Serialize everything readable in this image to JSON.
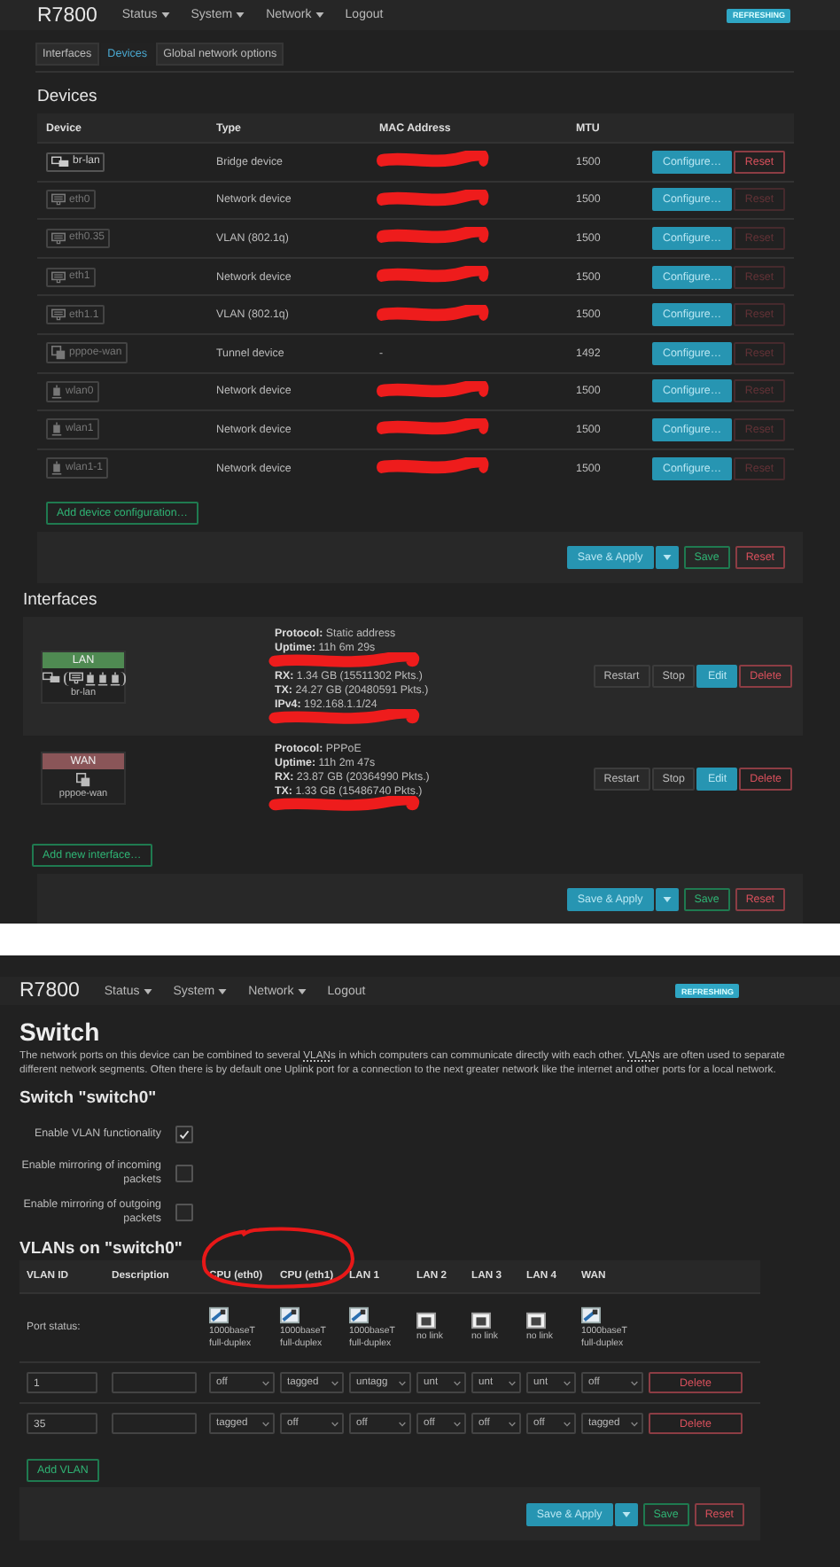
{
  "devices_page": {
    "navbar": {
      "brand": "R7800",
      "menus": [
        {
          "label": "Status",
          "dropdown": true
        },
        {
          "label": "System",
          "dropdown": true
        },
        {
          "label": "Network",
          "dropdown": true
        },
        {
          "label": "Logout",
          "dropdown": false
        }
      ],
      "badge": "REFRESHING"
    },
    "tabs": [
      {
        "label": "Interfaces",
        "selected": false
      },
      {
        "label": "Devices",
        "selected": true
      },
      {
        "label": "Global network options",
        "selected": false
      }
    ],
    "devices": {
      "heading": "Devices",
      "columns": [
        "Device",
        "Type",
        "MAC Address",
        "MTU"
      ],
      "rows": [
        {
          "name": "br-lan",
          "kind": "bridge",
          "type": "Bridge device",
          "mac_redacted": true,
          "mtu": "1500",
          "configure": "Configure…",
          "reset": "Reset",
          "configured": true
        },
        {
          "name": "eth0",
          "kind": "ethernet",
          "type": "Network device",
          "mac_redacted": true,
          "mtu": "1500",
          "configure": "Configure…",
          "reset": "Reset",
          "configured": false
        },
        {
          "name": "eth0.35",
          "kind": "ethernet",
          "type": "VLAN (802.1q)",
          "mac_redacted": true,
          "mtu": "1500",
          "configure": "Configure…",
          "reset": "Reset",
          "configured": false
        },
        {
          "name": "eth1",
          "kind": "ethernet",
          "type": "Network device",
          "mac_redacted": true,
          "mtu": "1500",
          "configure": "Configure…",
          "reset": "Reset",
          "configured": false
        },
        {
          "name": "eth1.1",
          "kind": "ethernet",
          "type": "VLAN (802.1q)",
          "mac_redacted": true,
          "mtu": "1500",
          "configure": "Configure…",
          "reset": "Reset",
          "configured": false
        },
        {
          "name": "pppoe-wan",
          "kind": "tunnel",
          "type": "Tunnel device",
          "mac": "-",
          "mac_redacted": false,
          "mtu": "1492",
          "configure": "Configure…",
          "reset": "Reset",
          "configured": false
        },
        {
          "name": "wlan0",
          "kind": "wifi",
          "type": "Network device",
          "mac_redacted": true,
          "mtu": "1500",
          "configure": "Configure…",
          "reset": "Reset",
          "configured": false
        },
        {
          "name": "wlan1",
          "kind": "wifi",
          "type": "Network device",
          "mac_redacted": true,
          "mtu": "1500",
          "configure": "Configure…",
          "reset": "Reset",
          "configured": false
        },
        {
          "name": "wlan1-1",
          "kind": "wifi",
          "type": "Network device",
          "mac_redacted": true,
          "mtu": "1500",
          "configure": "Configure…",
          "reset": "Reset",
          "configured": false
        }
      ],
      "add_button": "Add device configuration…"
    },
    "footer": {
      "save_apply": "Save & Apply",
      "save": "Save",
      "reset": "Reset"
    },
    "interfaces": {
      "heading": "Interfaces",
      "items": [
        {
          "name": "LAN",
          "color": "#4f8a52",
          "device_icon": {
            "kind": "bridge"
          },
          "members": [
            {
              "kind": "ethernet"
            },
            {
              "kind": "wifi"
            },
            {
              "kind": "wifi"
            },
            {
              "kind": "wifi"
            }
          ],
          "device": "br-lan",
          "lines": [
            {
              "kind": "field",
              "label": "Protocol:",
              "value": "Static address"
            },
            {
              "kind": "field",
              "label": "Uptime:",
              "value": "11h 6m 29s"
            },
            {
              "kind": "redacted"
            },
            {
              "kind": "field",
              "label": "RX:",
              "value": "1.34 GB (15511302 Pkts.)"
            },
            {
              "kind": "field",
              "label": "TX:",
              "value": "24.27 GB (20480591 Pkts.)"
            },
            {
              "kind": "field",
              "label": "IPv4:",
              "value": "192.168.1.1/24"
            },
            {
              "kind": "redacted"
            }
          ],
          "buttons": {
            "restart": "Restart",
            "stop": "Stop",
            "edit": "Edit",
            "delete": "Delete"
          }
        },
        {
          "name": "WAN",
          "color": "#8a5558",
          "device_icon": {
            "kind": "tunnel"
          },
          "device": "pppoe-wan",
          "lines": [
            {
              "kind": "field",
              "label": "Protocol:",
              "value": "PPPoE"
            },
            {
              "kind": "field",
              "label": "Uptime:",
              "value": "11h 2m 47s"
            },
            {
              "kind": "field",
              "label": "RX:",
              "value": "23.87 GB (20364990 Pkts.)"
            },
            {
              "kind": "field",
              "label": "TX:",
              "value": "1.33 GB (15486740 Pkts.)"
            },
            {
              "kind": "redacted"
            }
          ],
          "buttons": {
            "restart": "Restart",
            "stop": "Stop",
            "edit": "Edit",
            "delete": "Delete"
          }
        }
      ],
      "add_button": "Add new interface…"
    },
    "footer2": {
      "save_apply": "Save & Apply",
      "save": "Save",
      "reset": "Reset"
    }
  },
  "switch_page": {
    "navbar": {
      "brand": "R7800",
      "menus": [
        {
          "label": "Status",
          "dropdown": true
        },
        {
          "label": "System",
          "dropdown": true
        },
        {
          "label": "Network",
          "dropdown": true
        },
        {
          "label": "Logout",
          "dropdown": false
        }
      ],
      "badge": "REFRESHING"
    },
    "heading": "Switch",
    "description": [
      {
        "text": "The network ports on this device can be combined to several ",
        "abbr": false
      },
      {
        "text": "VLAN",
        "abbr": true
      },
      {
        "text": "s in which computers can communicate directly with each other. ",
        "abbr": false
      },
      {
        "text": "VLAN",
        "abbr": true
      },
      {
        "text": "s are often used to separate different network segments. Often there is by default one Uplink port for a connection to the next greater network like the internet and other ports for a local network.",
        "abbr": false
      }
    ],
    "switch_heading": "Switch \"switch0\"",
    "options": [
      {
        "label": "Enable VLAN functionality",
        "checked": true
      },
      {
        "label": "Enable mirroring of incoming packets",
        "checked": false
      },
      {
        "label": "Enable mirroring of outgoing packets",
        "checked": false
      }
    ],
    "vlans": {
      "heading": "VLANs on \"switch0\"",
      "circled": true,
      "columns": [
        "VLAN ID",
        "Description",
        "CPU (eth0)",
        "CPU (eth1)",
        "LAN 1",
        "LAN 2",
        "LAN 3",
        "LAN 4",
        "WAN"
      ],
      "port_status_label": "Port status:",
      "ports": [
        {
          "link": true,
          "lines": [
            "1000baseT",
            "full-duplex"
          ]
        },
        {
          "link": true,
          "lines": [
            "1000baseT",
            "full-duplex"
          ]
        },
        {
          "link": true,
          "lines": [
            "1000baseT",
            "full-duplex"
          ]
        },
        {
          "link": false,
          "lines": [
            "no link"
          ]
        },
        {
          "link": false,
          "lines": [
            "no link"
          ]
        },
        {
          "link": false,
          "lines": [
            "no link"
          ]
        },
        {
          "link": true,
          "lines": [
            "1000baseT",
            "full-duplex"
          ]
        }
      ],
      "rows": [
        {
          "id": "1",
          "ports": [
            "off",
            "tagged",
            "untagg",
            "unt",
            "unt",
            "unt",
            "off"
          ],
          "delete": "Delete"
        },
        {
          "id": "35",
          "ports": [
            "tagged",
            "off",
            "off",
            "off",
            "off",
            "off",
            "tagged"
          ],
          "delete": "Delete"
        }
      ],
      "add_button": "Add VLAN"
    },
    "footer": {
      "save_apply": "Save & Apply",
      "save": "Save",
      "reset": "Reset"
    }
  }
}
